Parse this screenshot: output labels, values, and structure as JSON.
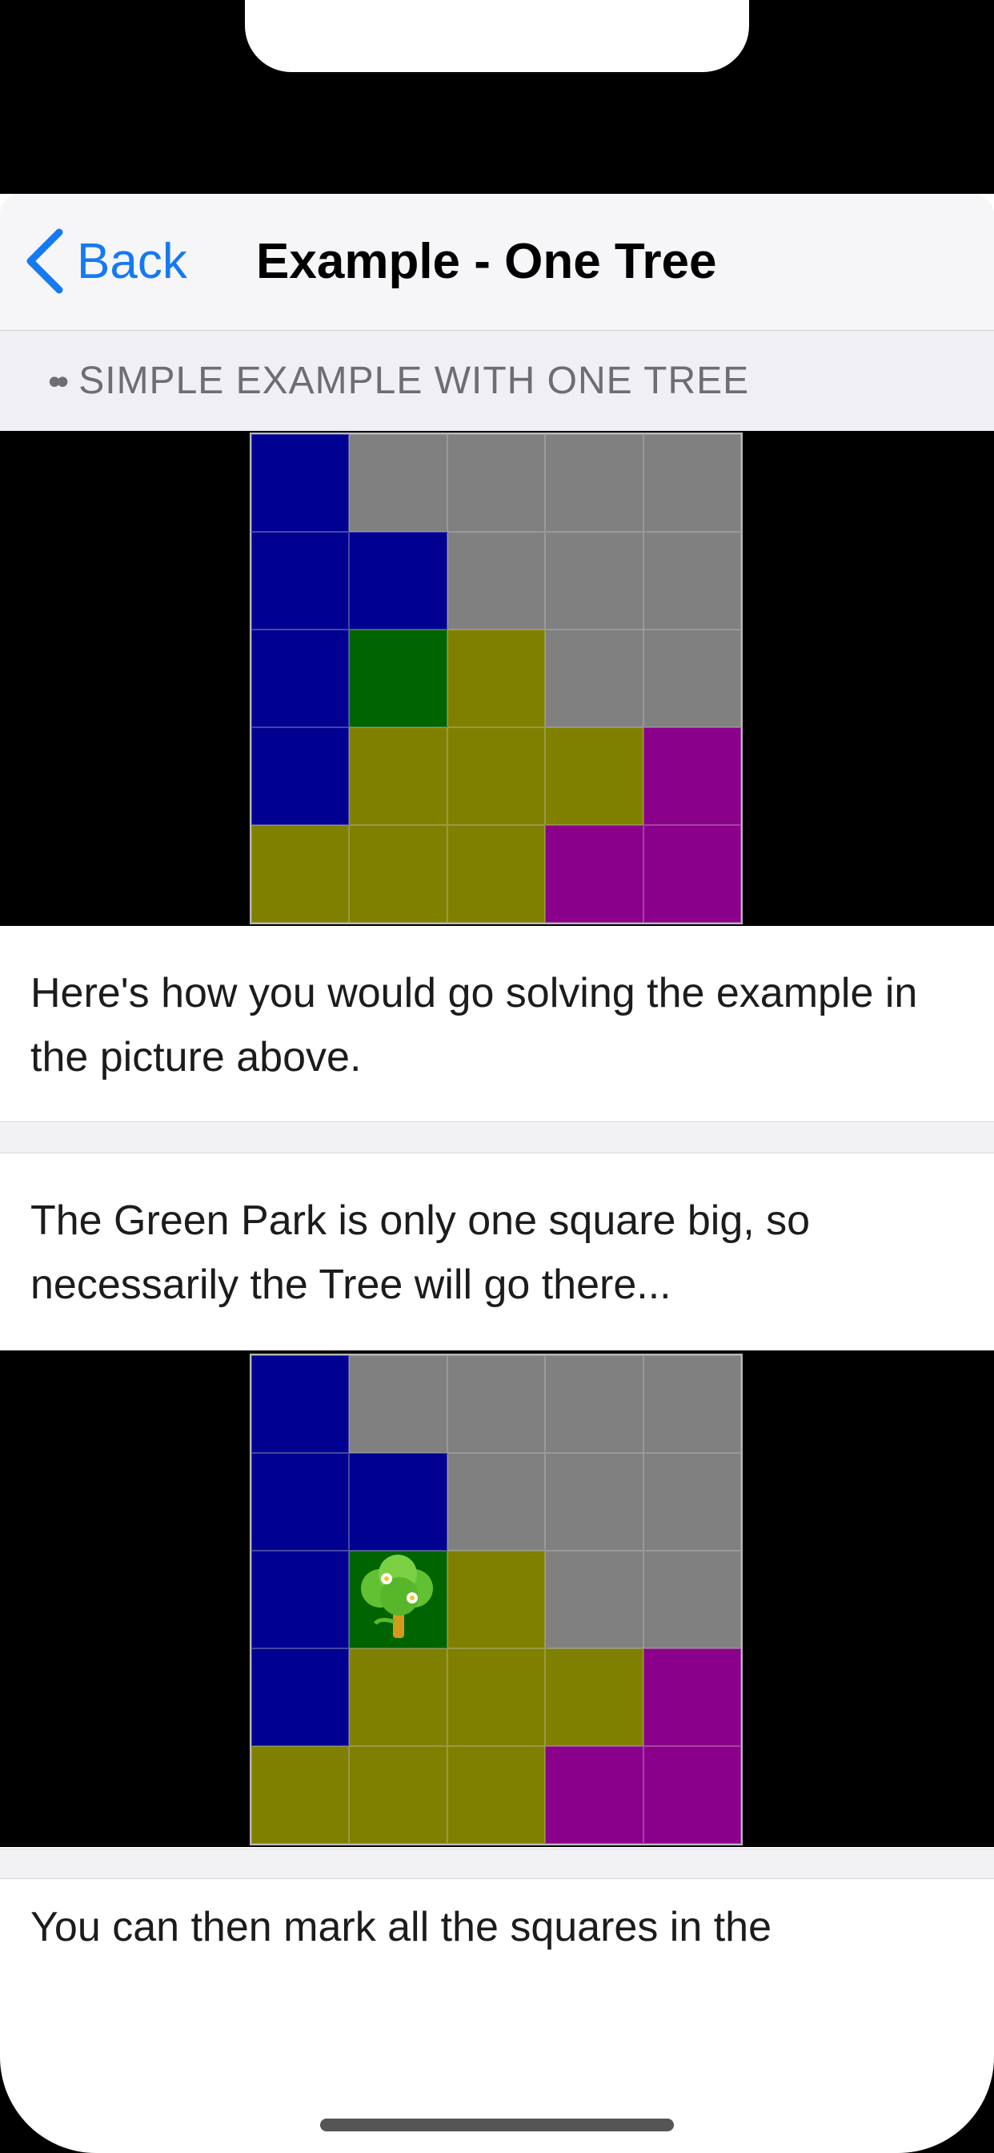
{
  "nav": {
    "back_label": "Back",
    "title": "Example - One Tree"
  },
  "section": {
    "dots": "••",
    "title": "SIMPLE EXAMPLE WITH ONE TREE"
  },
  "colors": {
    "blue": "#000091",
    "gray": "#808080",
    "green": "#006400",
    "olive": "#808000",
    "purple": "#8b008b",
    "accent": "#1579f2"
  },
  "puzzle": {
    "rows": [
      [
        "blue",
        "gray",
        "gray",
        "gray",
        "gray"
      ],
      [
        "blue",
        "blue",
        "gray",
        "gray",
        "gray"
      ],
      [
        "blue",
        "green",
        "olive",
        "gray",
        "gray"
      ],
      [
        "blue",
        "olive",
        "olive",
        "olive",
        "purple"
      ],
      [
        "olive",
        "olive",
        "olive",
        "purple",
        "purple"
      ]
    ],
    "tree_in_second_image": {
      "row": 3,
      "col": 2,
      "icon": "tree-icon"
    }
  },
  "texts": {
    "intro": "Here's how you would go solving the example in the picture above.",
    "green_park": "The Green Park is only one square big, so necessarily the Tree will go there...",
    "mark_squares": "You can then mark all the squares in the"
  }
}
